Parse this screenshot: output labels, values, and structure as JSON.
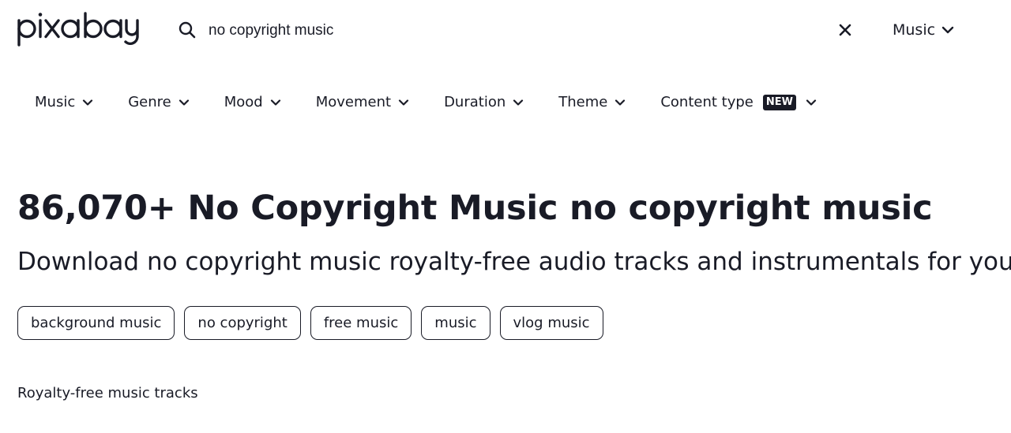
{
  "header": {
    "logo_text": "pixabay",
    "search": {
      "value": "no copyright music",
      "icon": "search-icon"
    },
    "clear_icon": "close-icon",
    "media_type": {
      "label": "Music",
      "icon": "chevron-down-icon"
    }
  },
  "filters": [
    {
      "label": "Music"
    },
    {
      "label": "Genre"
    },
    {
      "label": "Mood"
    },
    {
      "label": "Movement"
    },
    {
      "label": "Duration"
    },
    {
      "label": "Theme"
    },
    {
      "label": "Content type",
      "badge": "NEW"
    }
  ],
  "main": {
    "title": "86,070+ No Copyright Music no copyright music",
    "subtitle": "Download no copyright music royalty-free audio tracks and instrumentals for your",
    "tags": [
      "background music",
      "no copyright",
      "free music",
      "music",
      "vlog music"
    ],
    "section_label": "Royalty-free music tracks"
  }
}
